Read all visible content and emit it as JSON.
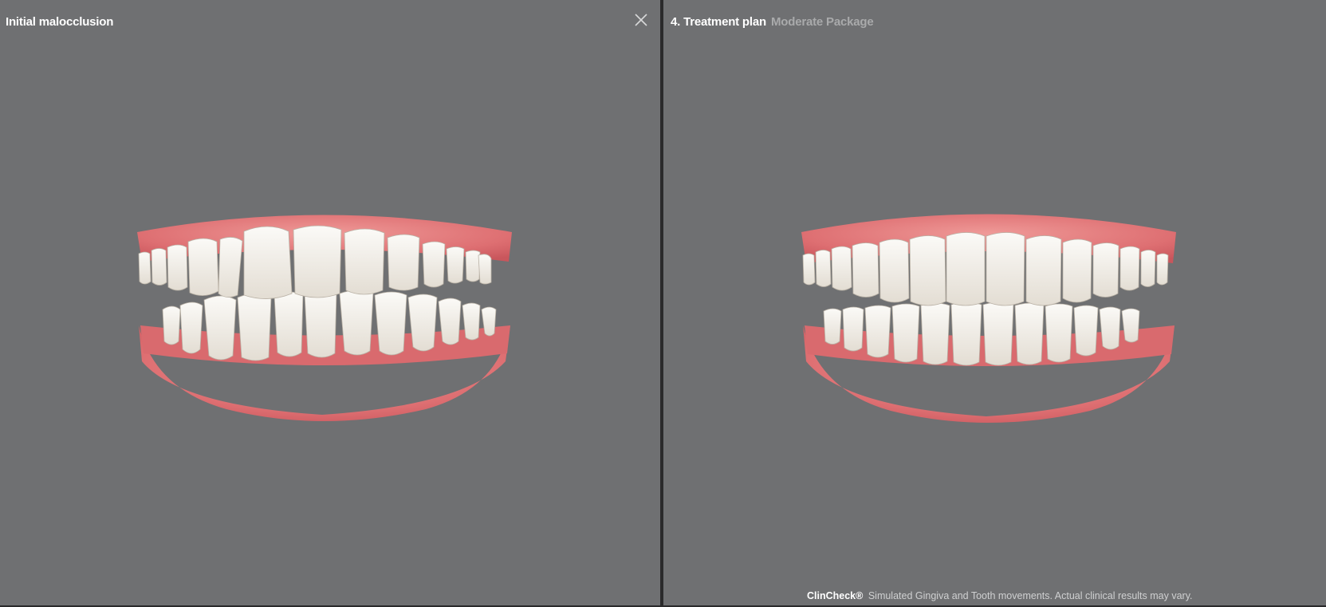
{
  "left_pane": {
    "title": "Initial malocclusion",
    "close_icon": "close-icon"
  },
  "right_pane": {
    "title": "4. Treatment plan",
    "subtitle": "Moderate Package"
  },
  "footer": {
    "brand": "ClinCheck®",
    "disclaimer": "Simulated Gingiva and Tooth movements. Actual clinical results may vary."
  },
  "colors": {
    "background": "#6f7072",
    "gum": "#e0767a",
    "tooth": "#f1ede6",
    "divider": "#2a2a2b"
  }
}
